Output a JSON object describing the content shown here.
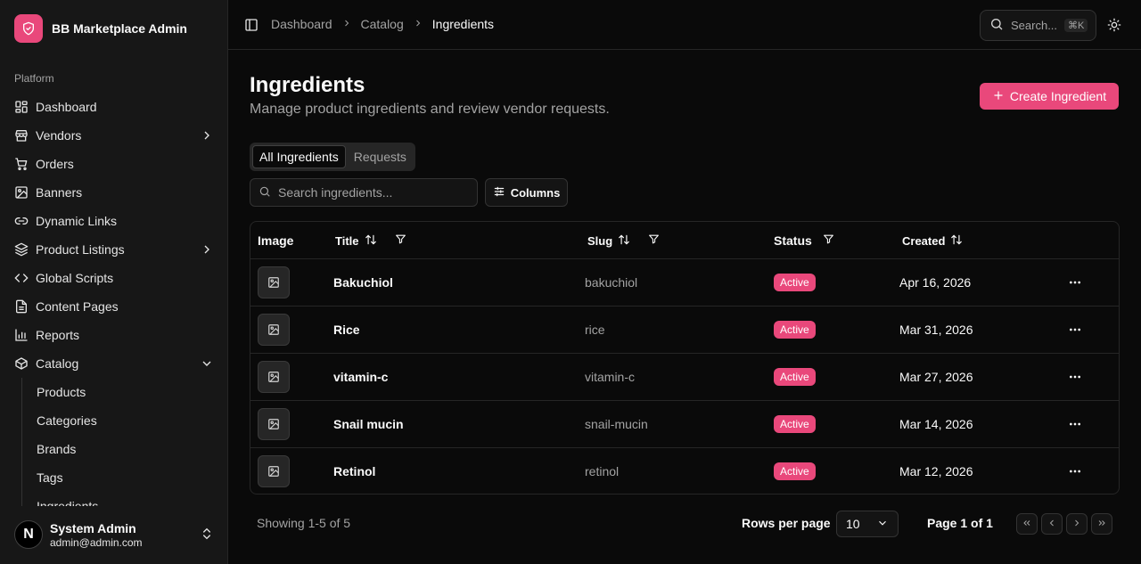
{
  "app": {
    "title": "BB Marketplace Admin"
  },
  "sidebar": {
    "group_label": "Platform",
    "items": [
      {
        "label": "Dashboard",
        "icon": "dashboard-icon",
        "has_chevron": false
      },
      {
        "label": "Vendors",
        "icon": "store-icon",
        "has_chevron": true
      },
      {
        "label": "Orders",
        "icon": "cart-icon",
        "has_chevron": false
      },
      {
        "label": "Banners",
        "icon": "image-icon",
        "has_chevron": false
      },
      {
        "label": "Dynamic Links",
        "icon": "link-icon",
        "has_chevron": false
      },
      {
        "label": "Product Listings",
        "icon": "layers-icon",
        "has_chevron": true
      },
      {
        "label": "Global Scripts",
        "icon": "code-icon",
        "has_chevron": false
      },
      {
        "label": "Content Pages",
        "icon": "file-icon",
        "has_chevron": false
      },
      {
        "label": "Reports",
        "icon": "bar-chart-icon",
        "has_chevron": false
      },
      {
        "label": "Catalog",
        "icon": "package-icon",
        "has_chevron": true,
        "expanded": true
      }
    ],
    "catalog_sub": [
      "Products",
      "Categories",
      "Brands",
      "Tags",
      "Ingredients"
    ],
    "user": {
      "initial": "N",
      "name": "System Admin",
      "email": "admin@admin.com"
    }
  },
  "header": {
    "breadcrumbs": [
      "Dashboard",
      "Catalog",
      "Ingredients"
    ],
    "search_placeholder": "Search...",
    "shortcut": "⌘K"
  },
  "page": {
    "title": "Ingredients",
    "subtitle": "Manage product ingredients and review vendor requests.",
    "create_label": "Create Ingredient",
    "tabs": [
      "All Ingredients",
      "Requests"
    ],
    "search_placeholder": "Search ingredients...",
    "columns_label": "Columns"
  },
  "table": {
    "headers": {
      "image": "Image",
      "title": "Title",
      "slug": "Slug",
      "status": "Status",
      "created": "Created"
    },
    "rows": [
      {
        "title": "Bakuchiol",
        "slug": "bakuchiol",
        "status": "Active",
        "created": "Apr 16, 2026"
      },
      {
        "title": "Rice",
        "slug": "rice",
        "status": "Active",
        "created": "Mar 31, 2026"
      },
      {
        "title": "vitamin-c",
        "slug": "vitamin-c",
        "status": "Active",
        "created": "Mar 27, 2026"
      },
      {
        "title": "Snail mucin",
        "slug": "snail-mucin",
        "status": "Active",
        "created": "Mar 14, 2026"
      },
      {
        "title": "Retinol",
        "slug": "retinol",
        "status": "Active",
        "created": "Mar 12, 2026"
      }
    ]
  },
  "footer": {
    "showing": "Showing 1-5 of 5",
    "rows_per_page_label": "Rows per page",
    "rows_per_page_value": "10",
    "page_label": "Page 1 of 1"
  },
  "colors": {
    "accent": "#e9487b",
    "background": "#0a0a0a",
    "sidebar": "#171717"
  }
}
